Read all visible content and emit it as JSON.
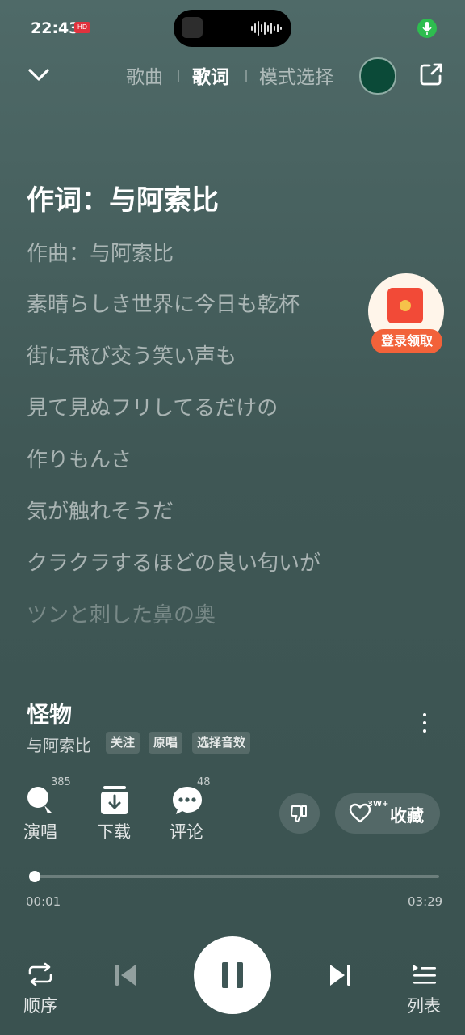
{
  "status_bar": {
    "time": "22:43",
    "hd_badge": "HD"
  },
  "nav": {
    "tabs": [
      {
        "label": "歌曲"
      },
      {
        "label": "歌词",
        "active": true
      },
      {
        "label": "模式选择"
      }
    ]
  },
  "lyrics": {
    "lines": [
      "作词：与阿索比",
      "作曲：与阿索比",
      "素晴らしき世界に今日も乾杯",
      "街に飛び交う笑い声も",
      "見て見ぬフリしてるだけの",
      "作りもんさ",
      "気が触れそうだ",
      "クラクラするほどの良い匂いが",
      "ツンと刺した鼻の奥"
    ],
    "current_index": 0
  },
  "promo": {
    "label": "登录领取"
  },
  "song": {
    "title": "怪物",
    "artist": "与阿索比",
    "tags": [
      "关注",
      "原唱",
      "选择音效"
    ]
  },
  "actions": {
    "sing": {
      "label": "演唱",
      "count": "385"
    },
    "download": {
      "label": "下载"
    },
    "comment": {
      "label": "评论",
      "count": "48"
    },
    "favorite": {
      "label": "收藏",
      "badge": "3W+"
    }
  },
  "progress": {
    "current": "00:01",
    "total": "03:29",
    "fraction": 0.005
  },
  "controls": {
    "mode_label": "顺序",
    "playlist_label": "列表"
  },
  "colors": {
    "background": "#465e5c",
    "accent": "#f2623a",
    "mic": "#2ebd4f"
  }
}
